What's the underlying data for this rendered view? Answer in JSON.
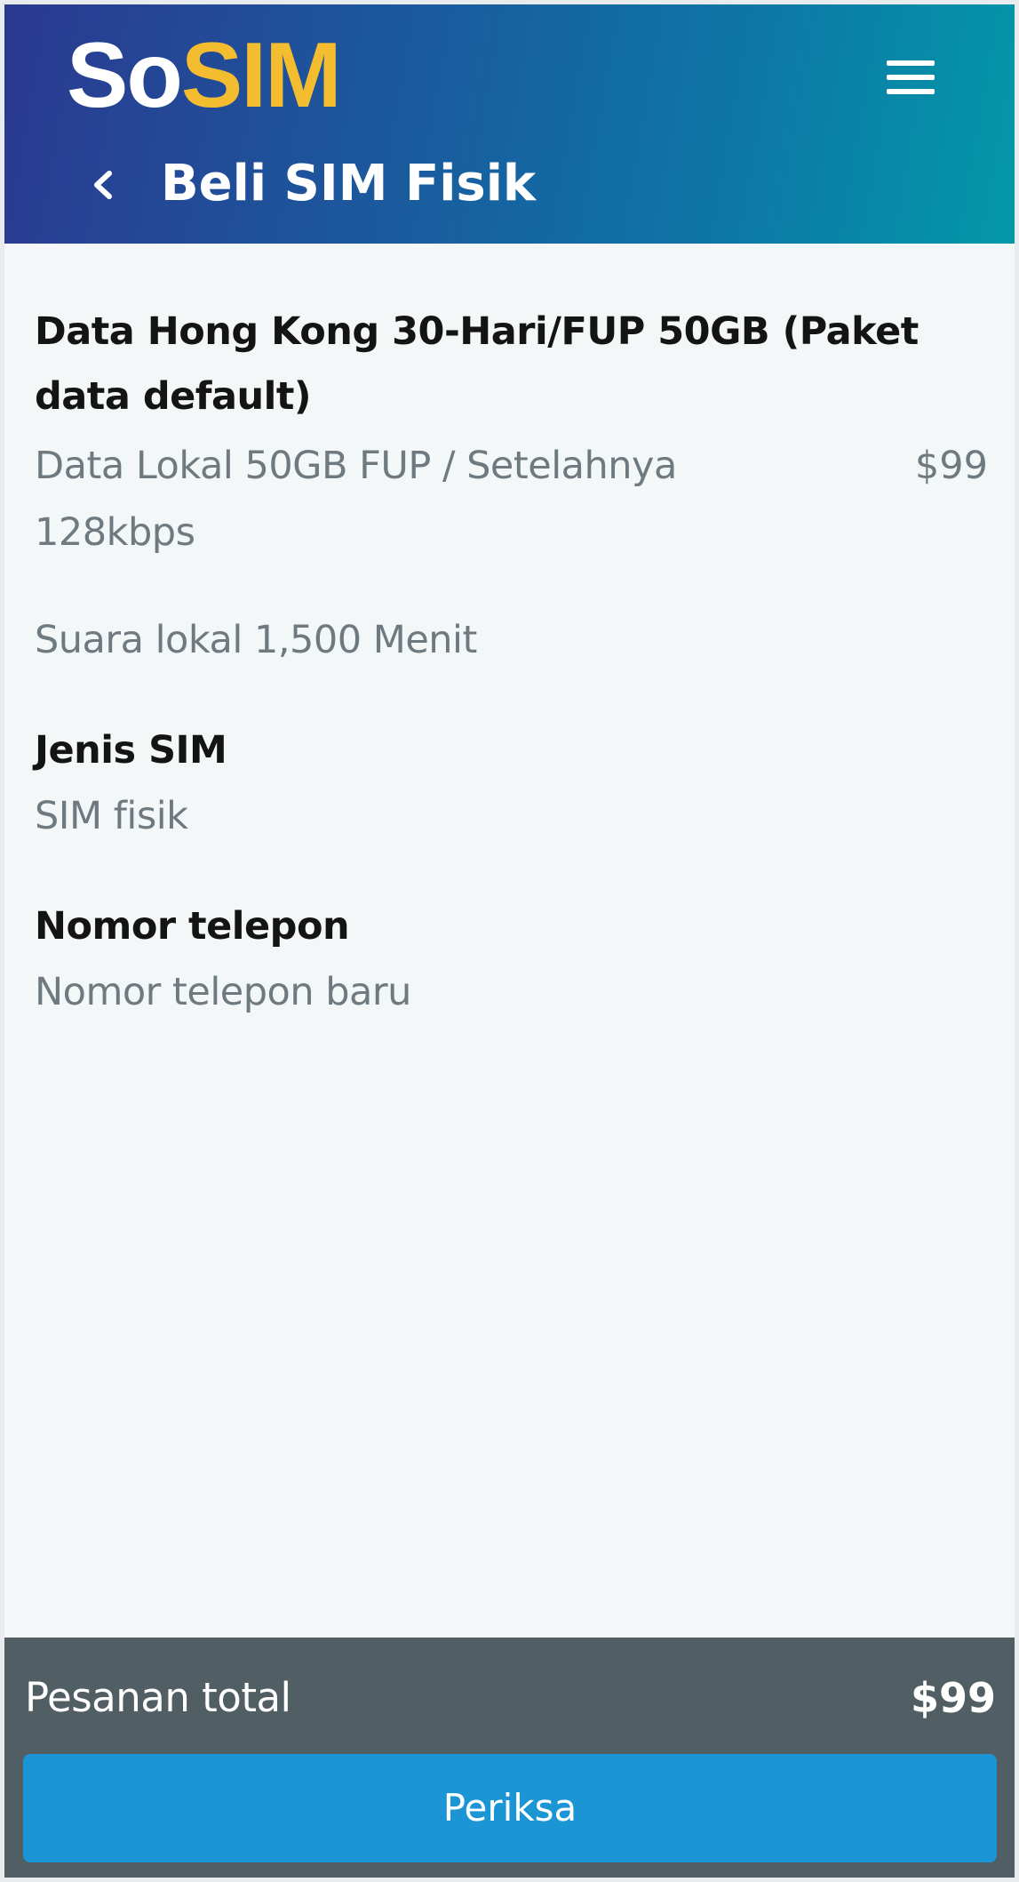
{
  "header": {
    "logo_part1": "So",
    "logo_part2": "SIM",
    "title": "Beli SIM Fisik",
    "menu_icon": "hamburger-menu-icon",
    "back_icon": "chevron-left-icon"
  },
  "plan": {
    "title": "Data Hong Kong 30-Hari/FUP 50GB (Paket data default)",
    "detail": "Data Lokal 50GB FUP / Setelahnya 128kbps",
    "price": "$99",
    "voice": "Suara lokal 1,500 Menit"
  },
  "sim_type": {
    "label": "Jenis SIM",
    "value": "SIM fisik"
  },
  "phone_number": {
    "label": "Nomor telepon",
    "value": "Nomor telepon baru"
  },
  "footer": {
    "total_label": "Pesanan total",
    "total_value": "$99",
    "button_label": "Periksa"
  },
  "colors": {
    "header_gradient_start": "#2b3990",
    "header_gradient_end": "#0399a8",
    "logo_accent": "#f3bd2f",
    "footer_bg": "#515e63",
    "button_bg": "#1c95d4",
    "muted_text": "#6f7a80"
  }
}
